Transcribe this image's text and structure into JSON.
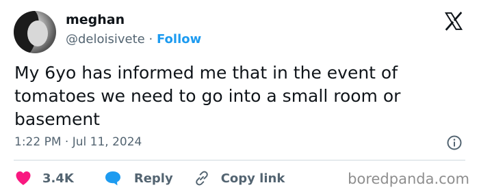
{
  "author": {
    "name": "meghan",
    "handle": "@deloisivete",
    "separator": "·",
    "follow_label": "Follow"
  },
  "tweet": {
    "text": "My 6yo has informed me that in the event of tomatoes we need to go into a small room or basement",
    "timestamp": "1:22 PM · Jul 11, 2024"
  },
  "actions": {
    "likes": "3.4K",
    "reply_label": "Reply",
    "copy_link_label": "Copy link"
  },
  "watermark": "boredpanda.com",
  "colors": {
    "text": "#0f1419",
    "secondary": "#536471",
    "accent": "#1d9bf0",
    "like": "#f91880",
    "divider": "#cfd9de"
  },
  "icons": [
    "x-logo-icon",
    "info-icon",
    "heart-icon",
    "reply-bubble-icon",
    "link-icon"
  ]
}
